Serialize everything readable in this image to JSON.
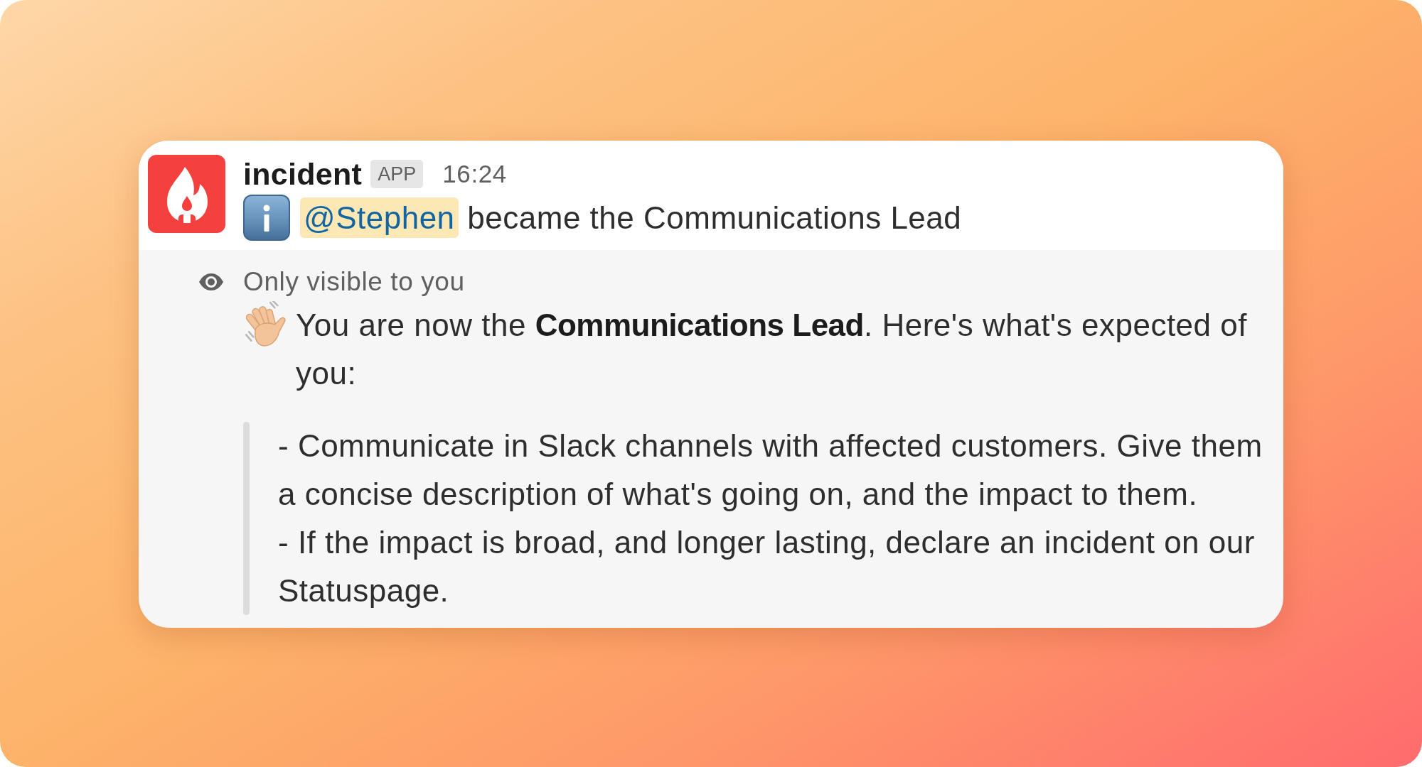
{
  "message": {
    "sender": "incident",
    "badge": "APP",
    "time": "16:24",
    "mention": "@Stephen",
    "text": "became the Communications Lead"
  },
  "ephemeral": {
    "notice": "Only visible to you",
    "intro": "You are now the **Communications Lead**. Here's what's expected of you:",
    "quote": [
      "- Communicate in Slack channels with affected customers. Give them a concise description of what's going on, and the impact to them.",
      "- If the impact is broad, and longer lasting, declare an incident on our Statuspage."
    ]
  }
}
